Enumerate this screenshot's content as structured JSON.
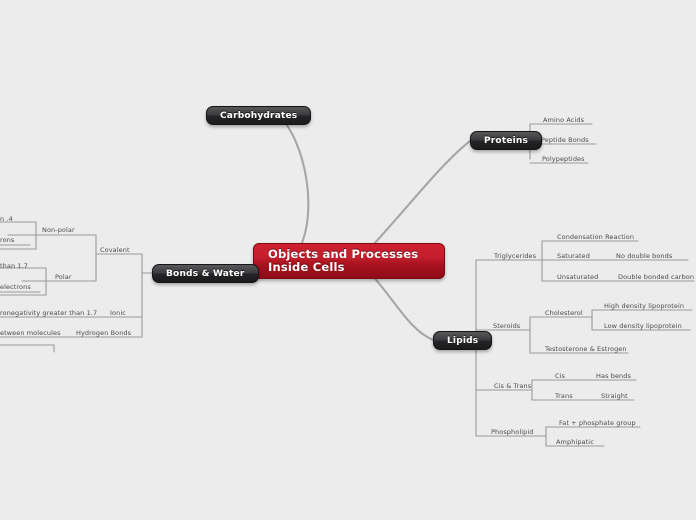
{
  "diagram": {
    "type": "mind-map",
    "title": "Objects and Processes Inside Cells",
    "background_color": "#ececec",
    "root_color": "#b81b28",
    "branch_color": "#2b2b2d",
    "connector_color": "#9a9a9a"
  },
  "root": {
    "label": "Objects and Processes Inside Cells"
  },
  "branches": {
    "carbohydrates": {
      "label": "Carbohydrates"
    },
    "proteins": {
      "label": "Proteins",
      "children": [
        {
          "label": "Amino Acids"
        },
        {
          "label": "Peptide Bonds"
        },
        {
          "label": "Polypeptides"
        }
      ]
    },
    "lipids": {
      "label": "Lipids",
      "children": [
        {
          "label": "Triglycerides",
          "children": [
            {
              "label": "Condensation Reaction"
            },
            {
              "label": "Saturated",
              "detail": "No double bonds"
            },
            {
              "label": "Unsaturated",
              "detail": "Double bonded carbon"
            }
          ]
        },
        {
          "label": "Steroids",
          "children": [
            {
              "label": "Cholesterol",
              "children": [
                {
                  "label": "High density lipoprotein"
                },
                {
                  "label": "Low density lipoprotein"
                }
              ]
            },
            {
              "label": "Testosterone & Estrogen"
            }
          ]
        },
        {
          "label": "Cis & Trans",
          "children": [
            {
              "label": "Cis",
              "detail": "Has bends"
            },
            {
              "label": "Trans",
              "detail": "Straight"
            }
          ]
        },
        {
          "label": "Phospholipid",
          "children": [
            {
              "label": "Fat + phosphate group"
            },
            {
              "label": "Amphipatic"
            }
          ]
        }
      ]
    },
    "bonds_water": {
      "label": "Bonds & Water",
      "children": [
        {
          "label": "Covalent",
          "children": [
            {
              "label": "Non-polar",
              "detail_top": "n .4",
              "detail_bottom": "rons"
            },
            {
              "label": "Polar",
              "detail_top": "than 1.7",
              "detail_bottom": "electrons"
            }
          ]
        },
        {
          "label": "Ionic",
          "detail": "ronegativity greater than 1.7"
        },
        {
          "label": "Hydrogen Bonds",
          "detail": "etween molecules"
        }
      ]
    }
  }
}
